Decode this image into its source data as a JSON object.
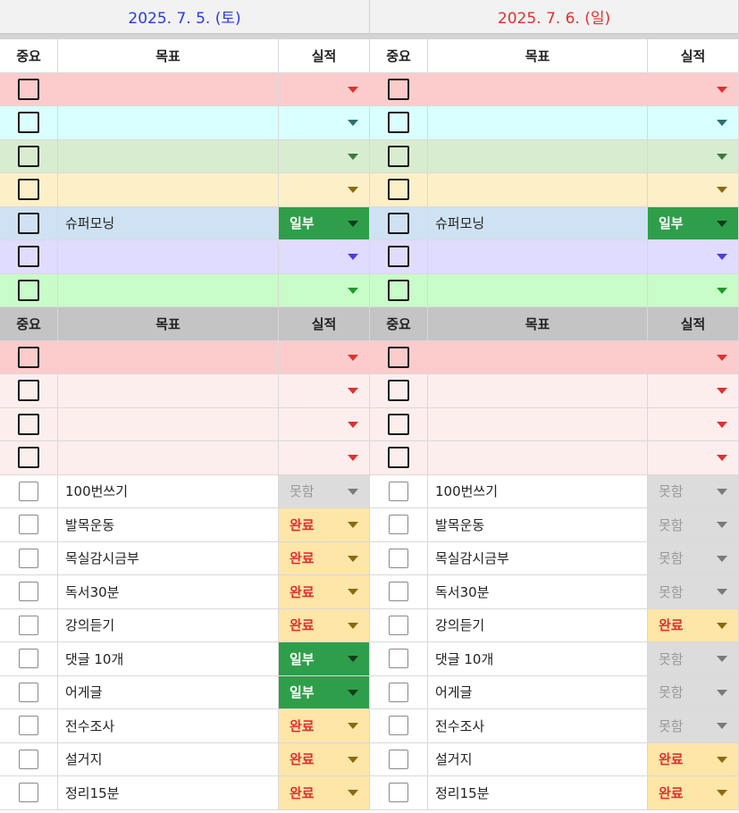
{
  "days": [
    {
      "date": "2025. 7. 5. (토)",
      "headers": {
        "importance": "중요",
        "goal": "목표",
        "result": "실적"
      },
      "section1": [
        {
          "bg": "#fccccc",
          "arrow": "#e03030",
          "goal": "",
          "result": "",
          "resultStyle": "none"
        },
        {
          "bg": "#d9ffff",
          "arrow": "#2a7070",
          "goal": "",
          "result": "",
          "resultStyle": "none"
        },
        {
          "bg": "#d8ecd0",
          "arrow": "#3d7a3d",
          "goal": "",
          "result": "",
          "resultStyle": "none"
        },
        {
          "bg": "#fdf0c8",
          "arrow": "#8a6a10",
          "goal": "",
          "result": "",
          "resultStyle": "none"
        },
        {
          "bg": "#cfe2f3",
          "arrow": "#1a1a1a",
          "goal": "슈퍼모닝",
          "result": "일부",
          "resultStyle": "green"
        },
        {
          "bg": "#e0dcff",
          "arrow": "#4b3de0",
          "goal": "",
          "result": "",
          "resultStyle": "none"
        },
        {
          "bg": "#c8fcc8",
          "arrow": "#1f9a2a",
          "goal": "",
          "result": "",
          "resultStyle": "none"
        }
      ],
      "section2_pink": [
        {
          "bg": "#fccccc",
          "goal": "",
          "result": ""
        },
        {
          "bg": "#fdeeee",
          "goal": "",
          "result": ""
        },
        {
          "bg": "#fdeeee",
          "goal": "",
          "result": ""
        },
        {
          "bg": "#fdeeee",
          "goal": "",
          "result": ""
        }
      ],
      "section2_items": [
        {
          "goal": "100번쓰기",
          "result": "못함",
          "resultStyle": "gray"
        },
        {
          "goal": "발목운동",
          "result": "완료",
          "resultStyle": "orange"
        },
        {
          "goal": "목실감시금부",
          "result": "완료",
          "resultStyle": "orange"
        },
        {
          "goal": "독서30분",
          "result": "완료",
          "resultStyle": "orange"
        },
        {
          "goal": "강의듣기",
          "result": "완료",
          "resultStyle": "orange"
        },
        {
          "goal": "댓글 10개",
          "result": "일부",
          "resultStyle": "green"
        },
        {
          "goal": "어게글",
          "result": "일부",
          "resultStyle": "green"
        },
        {
          "goal": "전수조사",
          "result": "완료",
          "resultStyle": "orange"
        },
        {
          "goal": "설거지",
          "result": "완료",
          "resultStyle": "orange"
        },
        {
          "goal": "정리15분",
          "result": "완료",
          "resultStyle": "orange"
        }
      ]
    },
    {
      "date": "2025. 7. 6. (일)",
      "headers": {
        "importance": "중요",
        "goal": "목표",
        "result": "실적"
      },
      "section1": [
        {
          "bg": "#fccccc",
          "arrow": "#e03030",
          "goal": "",
          "result": "",
          "resultStyle": "none"
        },
        {
          "bg": "#d9ffff",
          "arrow": "#2a7070",
          "goal": "",
          "result": "",
          "resultStyle": "none"
        },
        {
          "bg": "#d8ecd0",
          "arrow": "#3d7a3d",
          "goal": "",
          "result": "",
          "resultStyle": "none"
        },
        {
          "bg": "#fdf0c8",
          "arrow": "#8a6a10",
          "goal": "",
          "result": "",
          "resultStyle": "none"
        },
        {
          "bg": "#cfe2f3",
          "arrow": "#1a1a1a",
          "goal": "슈퍼모닝",
          "result": "일부",
          "resultStyle": "green"
        },
        {
          "bg": "#e0dcff",
          "arrow": "#4b3de0",
          "goal": "",
          "result": "",
          "resultStyle": "none"
        },
        {
          "bg": "#c8fcc8",
          "arrow": "#1f9a2a",
          "goal": "",
          "result": "",
          "resultStyle": "none"
        }
      ],
      "section2_pink": [
        {
          "bg": "#fccccc",
          "goal": "",
          "result": ""
        },
        {
          "bg": "#fdeeee",
          "goal": "",
          "result": ""
        },
        {
          "bg": "#fdeeee",
          "goal": "",
          "result": ""
        },
        {
          "bg": "#fdeeee",
          "goal": "",
          "result": ""
        }
      ],
      "section2_items": [
        {
          "goal": "100번쓰기",
          "result": "못함",
          "resultStyle": "gray"
        },
        {
          "goal": "발목운동",
          "result": "못함",
          "resultStyle": "gray"
        },
        {
          "goal": "목실감시금부",
          "result": "못함",
          "resultStyle": "gray"
        },
        {
          "goal": "독서30분",
          "result": "못함",
          "resultStyle": "gray"
        },
        {
          "goal": "강의듣기",
          "result": "완료",
          "resultStyle": "orange"
        },
        {
          "goal": "댓글 10개",
          "result": "못함",
          "resultStyle": "gray"
        },
        {
          "goal": "어게글",
          "result": "못함",
          "resultStyle": "gray"
        },
        {
          "goal": "전수조사",
          "result": "못함",
          "resultStyle": "gray"
        },
        {
          "goal": "설거지",
          "result": "완료",
          "resultStyle": "orange"
        },
        {
          "goal": "정리15분",
          "result": "완료",
          "resultStyle": "orange"
        }
      ]
    }
  ]
}
